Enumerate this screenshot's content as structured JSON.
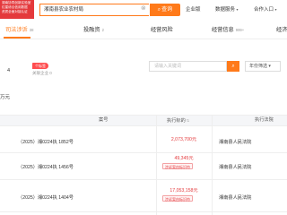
{
  "header": {
    "logo_lines": [
      "湖南协同创新实验室",
      "红星综合信用数据",
      "资质全面对接认证"
    ],
    "search_value": "湘南县农业农村局",
    "search_button": "查询",
    "nav": [
      {
        "label": "企业版",
        "caret": ""
      },
      {
        "label": "数据服务",
        "caret": "▾"
      },
      {
        "label": "合作入口",
        "caret": "▾"
      }
    ]
  },
  "tabs": [
    {
      "label": "司法涉诉",
      "count": "38"
    },
    {
      "label": "投融资",
      "count": "2"
    },
    {
      "label": "经营风险",
      "count": ""
    },
    {
      "label": "经营信息",
      "count": "999+"
    },
    {
      "label": "经济",
      "count": ""
    }
  ],
  "summary": {
    "count_text": "4",
    "badge": "个标签",
    "related": "关联企业 0",
    "filter_placeholder": "请输入关键词",
    "year_label": "年份筛选 ▾",
    "unit": "万元"
  },
  "table": {
    "headers": {
      "case_no": "案号",
      "amount": "执行标的",
      "court": "执行法院"
    },
    "rows": [
      {
        "case_no": "（2025）湘0224执 1852号",
        "amount": "2,073,700元",
        "tag": "",
        "court": "湘南县人民法院"
      },
      {
        "case_no": "（2025）湘0224执 1456号",
        "amount": "49,345元",
        "tag": "涉诉案由标识符",
        "court": "湘南县人民法院"
      },
      {
        "case_no": "（2025）湘0224执 1404号",
        "amount": "17,053,158元",
        "tag": "涉诉案由标识符",
        "court": "湘南县人民法院"
      }
    ]
  },
  "colors": {
    "accent": "#ff7a1a",
    "amount_red": "#e4393c",
    "header_bg": "#f5f6f8"
  }
}
